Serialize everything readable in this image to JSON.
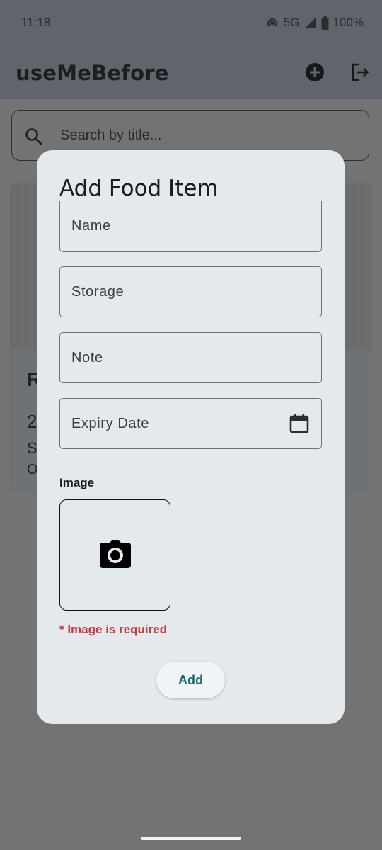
{
  "status_bar": {
    "time": "11:18",
    "network": "5G",
    "battery": "100%"
  },
  "app_bar": {
    "title": "useMeBefore",
    "icons": [
      "add-circle-icon",
      "logout-icon"
    ]
  },
  "search": {
    "placeholder": "Search by title..."
  },
  "background_card": {
    "title_partial": "R",
    "line1_partial": "2",
    "line2_partial": "S",
    "line3_partial": "O"
  },
  "dialog": {
    "title": "Add Food Item",
    "fields": {
      "name_label": "Name",
      "storage_label": "Storage",
      "note_label": "Note",
      "expiry_label": "Expiry Date"
    },
    "image_label": "Image",
    "image_error": "* Image is required",
    "add_button": "Add"
  },
  "colors": {
    "error": "#c43a3a",
    "accent": "#1d6b6f",
    "dialog_bg": "#e4e9ed"
  }
}
